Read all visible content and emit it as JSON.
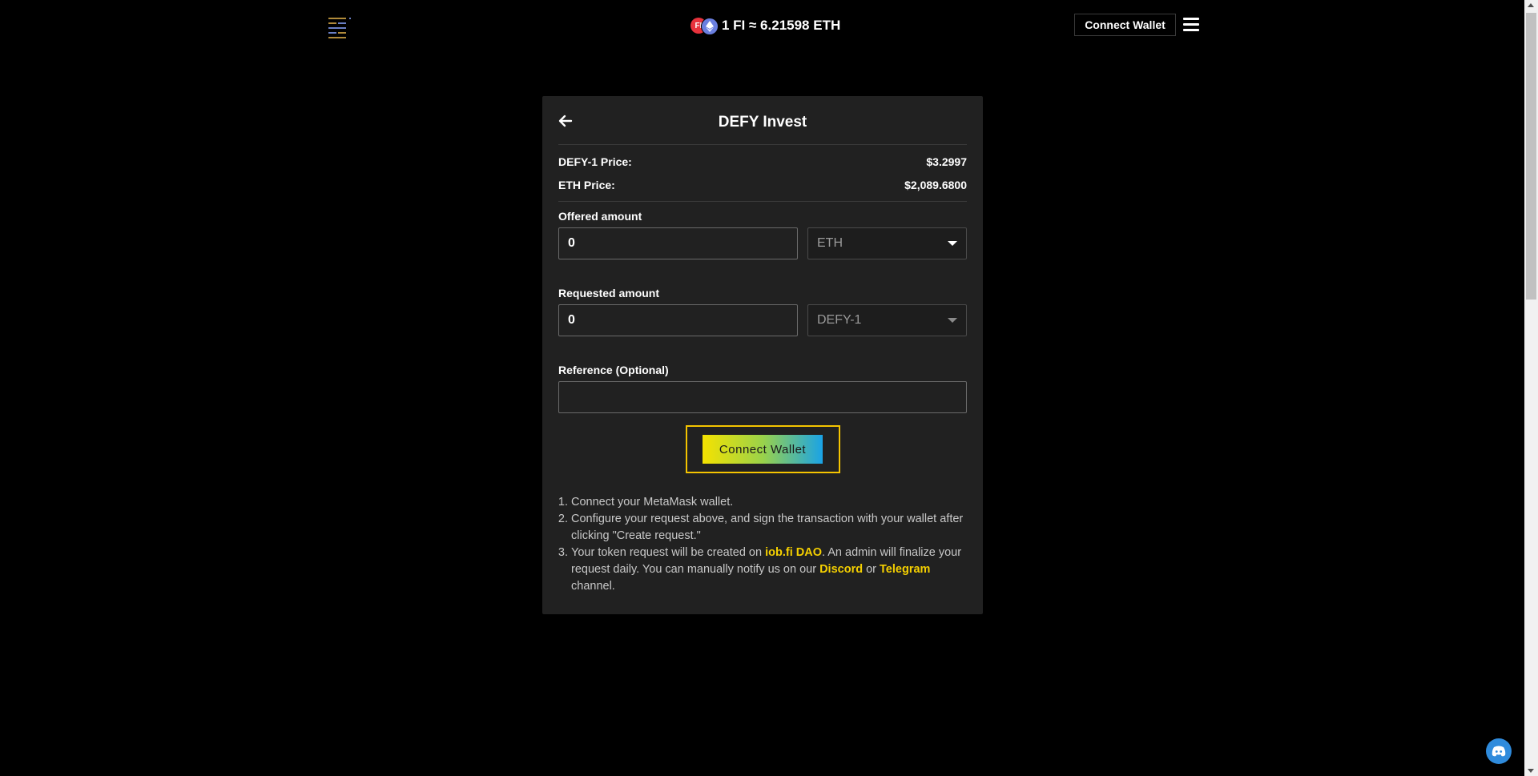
{
  "header": {
    "rate_text": "1 FI ≈ 6.21598 ETH",
    "fi_coin_glyph": "FI",
    "connect_label": "Connect Wallet"
  },
  "card": {
    "title": "DEFY Invest",
    "prices": [
      {
        "label": "DEFY-1 Price:",
        "value": "$3.2997"
      },
      {
        "label": "ETH Price:",
        "value": "$2,089.6800"
      }
    ],
    "offered": {
      "label": "Offered amount",
      "value": "0",
      "token": "ETH"
    },
    "requested": {
      "label": "Requested amount",
      "value": "0",
      "token": "DEFY-1"
    },
    "reference": {
      "label": "Reference (Optional)",
      "value": ""
    },
    "connect_button": "Connect Wallet",
    "steps": {
      "s1": "Connect your MetaMask wallet.",
      "s2": "Configure your request above, and sign the transaction with your wallet after clicking \"Create request.\"",
      "s3_a": "Your token request will be created on ",
      "s3_link": "iob.fi DAO",
      "s3_b": ". An admin will finalize your request daily. You can manually notify us on our ",
      "s3_discord": "Discord",
      "s3_or": " or ",
      "s3_telegram": "Telegram",
      "s3_c": " channel."
    }
  },
  "colors": {
    "background": "#000000",
    "card": "#212121",
    "accent_yellow": "#f5d000",
    "discord_blue": "#2f8bdc"
  },
  "icons": [
    "logo-icon",
    "fi-coin-icon",
    "eth-coin-icon",
    "hamburger-menu-icon",
    "back-arrow-icon",
    "caret-down-icon",
    "discord-icon"
  ]
}
